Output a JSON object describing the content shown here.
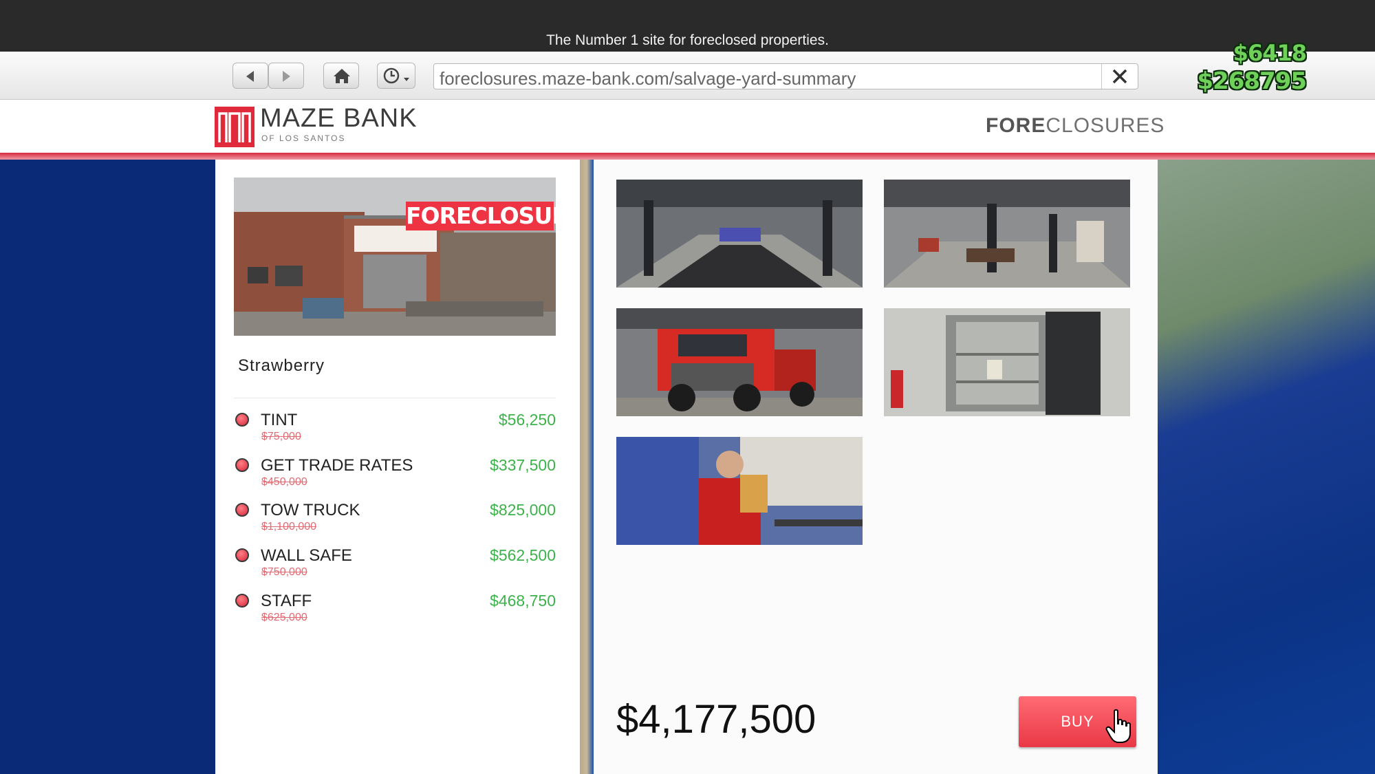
{
  "tagline": "The Number 1 site for foreclosed properties.",
  "browser": {
    "url": "foreclosures.maze-bank.com/salvage-yard-summary"
  },
  "hud": {
    "cash": "$6418",
    "bank": "$268795",
    "cash_color": "#6fd15a"
  },
  "header": {
    "logo_title": "MAZE BANK",
    "logo_subtitle": "OF LOS SANTOS",
    "section_bold": "FORE",
    "section_rest": "CLOSURES",
    "accent_color": "#d6283f"
  },
  "property": {
    "banner": "FORECLOSURE",
    "location": "Strawberry",
    "items": [
      {
        "name": "TINT",
        "price": "$56,250",
        "old_price": "$75,000"
      },
      {
        "name": "GET TRADE RATES",
        "price": "$337,500",
        "old_price": "$450,000"
      },
      {
        "name": "TOW TRUCK",
        "price": "$825,000",
        "old_price": "$1,100,000"
      },
      {
        "name": "WALL SAFE",
        "price": "$562,500",
        "old_price": "$750,000"
      },
      {
        "name": "STAFF",
        "price": "$468,750",
        "old_price": "$625,000"
      }
    ]
  },
  "gallery_icons": [
    "garage-interior-thumbnail",
    "workshop-lifts-thumbnail",
    "tow-truck-thumbnail",
    "wall-safe-thumbnail",
    "staff-thumbnail"
  ],
  "checkout": {
    "total": "$4,177,500",
    "buy_label": "BUY"
  }
}
